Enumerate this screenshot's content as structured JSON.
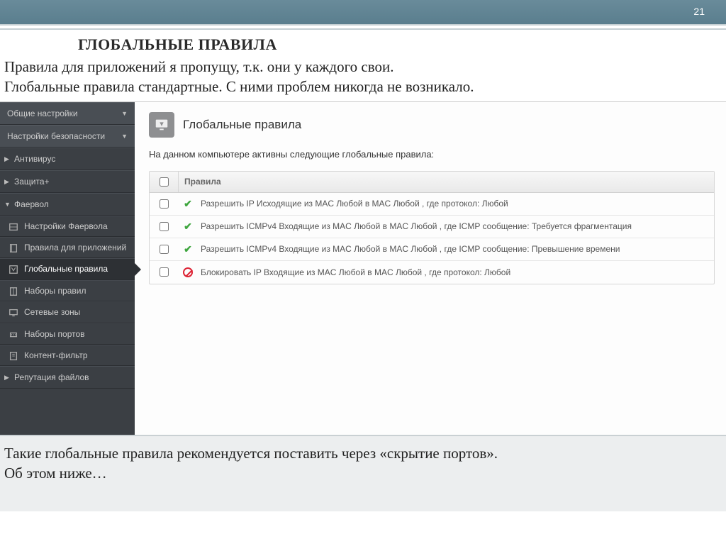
{
  "page_number": "21",
  "slide_title": "ГЛОБАЛЬНЫЕ ПРАВИЛА",
  "intro_line1": "Правила для приложений я пропущу, т.к. они у каждого свои.",
  "intro_line2": "Глобальные правила стандартные. С ними проблем никогда не возникало.",
  "sidebar": {
    "general": "Общие настройки",
    "security": "Настройки безопасности",
    "antivirus": "Антивирус",
    "defense": "Защита+",
    "firewall": "Фаервол",
    "fw_settings": "Настройки Фаервола",
    "app_rules": "Правила для приложений",
    "global_rules": "Глобальные правила",
    "rule_sets": "Наборы правил",
    "net_zones": "Сетевые зоны",
    "port_sets": "Наборы портов",
    "content_filter": "Контент-фильтр",
    "file_rep": "Репутация файлов"
  },
  "content": {
    "title": "Глобальные правила",
    "subtitle": "На данном компьютере активны следующие глобальные правила:",
    "header": "Правила",
    "rules": [
      {
        "status": "allow",
        "text": "Разрешить IP Исходящие из MAC Любой в MAC Любой , где протокол: Любой"
      },
      {
        "status": "allow",
        "text": "Разрешить ICMPv4 Входящие из MAC Любой в MAC Любой , где ICMP сообщение: Требуется фрагментация"
      },
      {
        "status": "allow",
        "text": "Разрешить ICMPv4 Входящие из MAC Любой в MAC Любой , где ICMP сообщение: Превышение времени"
      },
      {
        "status": "block",
        "text": "Блокировать IP Входящие из MAC Любой в MAC Любой , где протокол: Любой"
      }
    ]
  },
  "footer_line1": "Такие глобальные правила рекомендуется поставить через «скрытие портов».",
  "footer_line2": "Об этом ниже…"
}
